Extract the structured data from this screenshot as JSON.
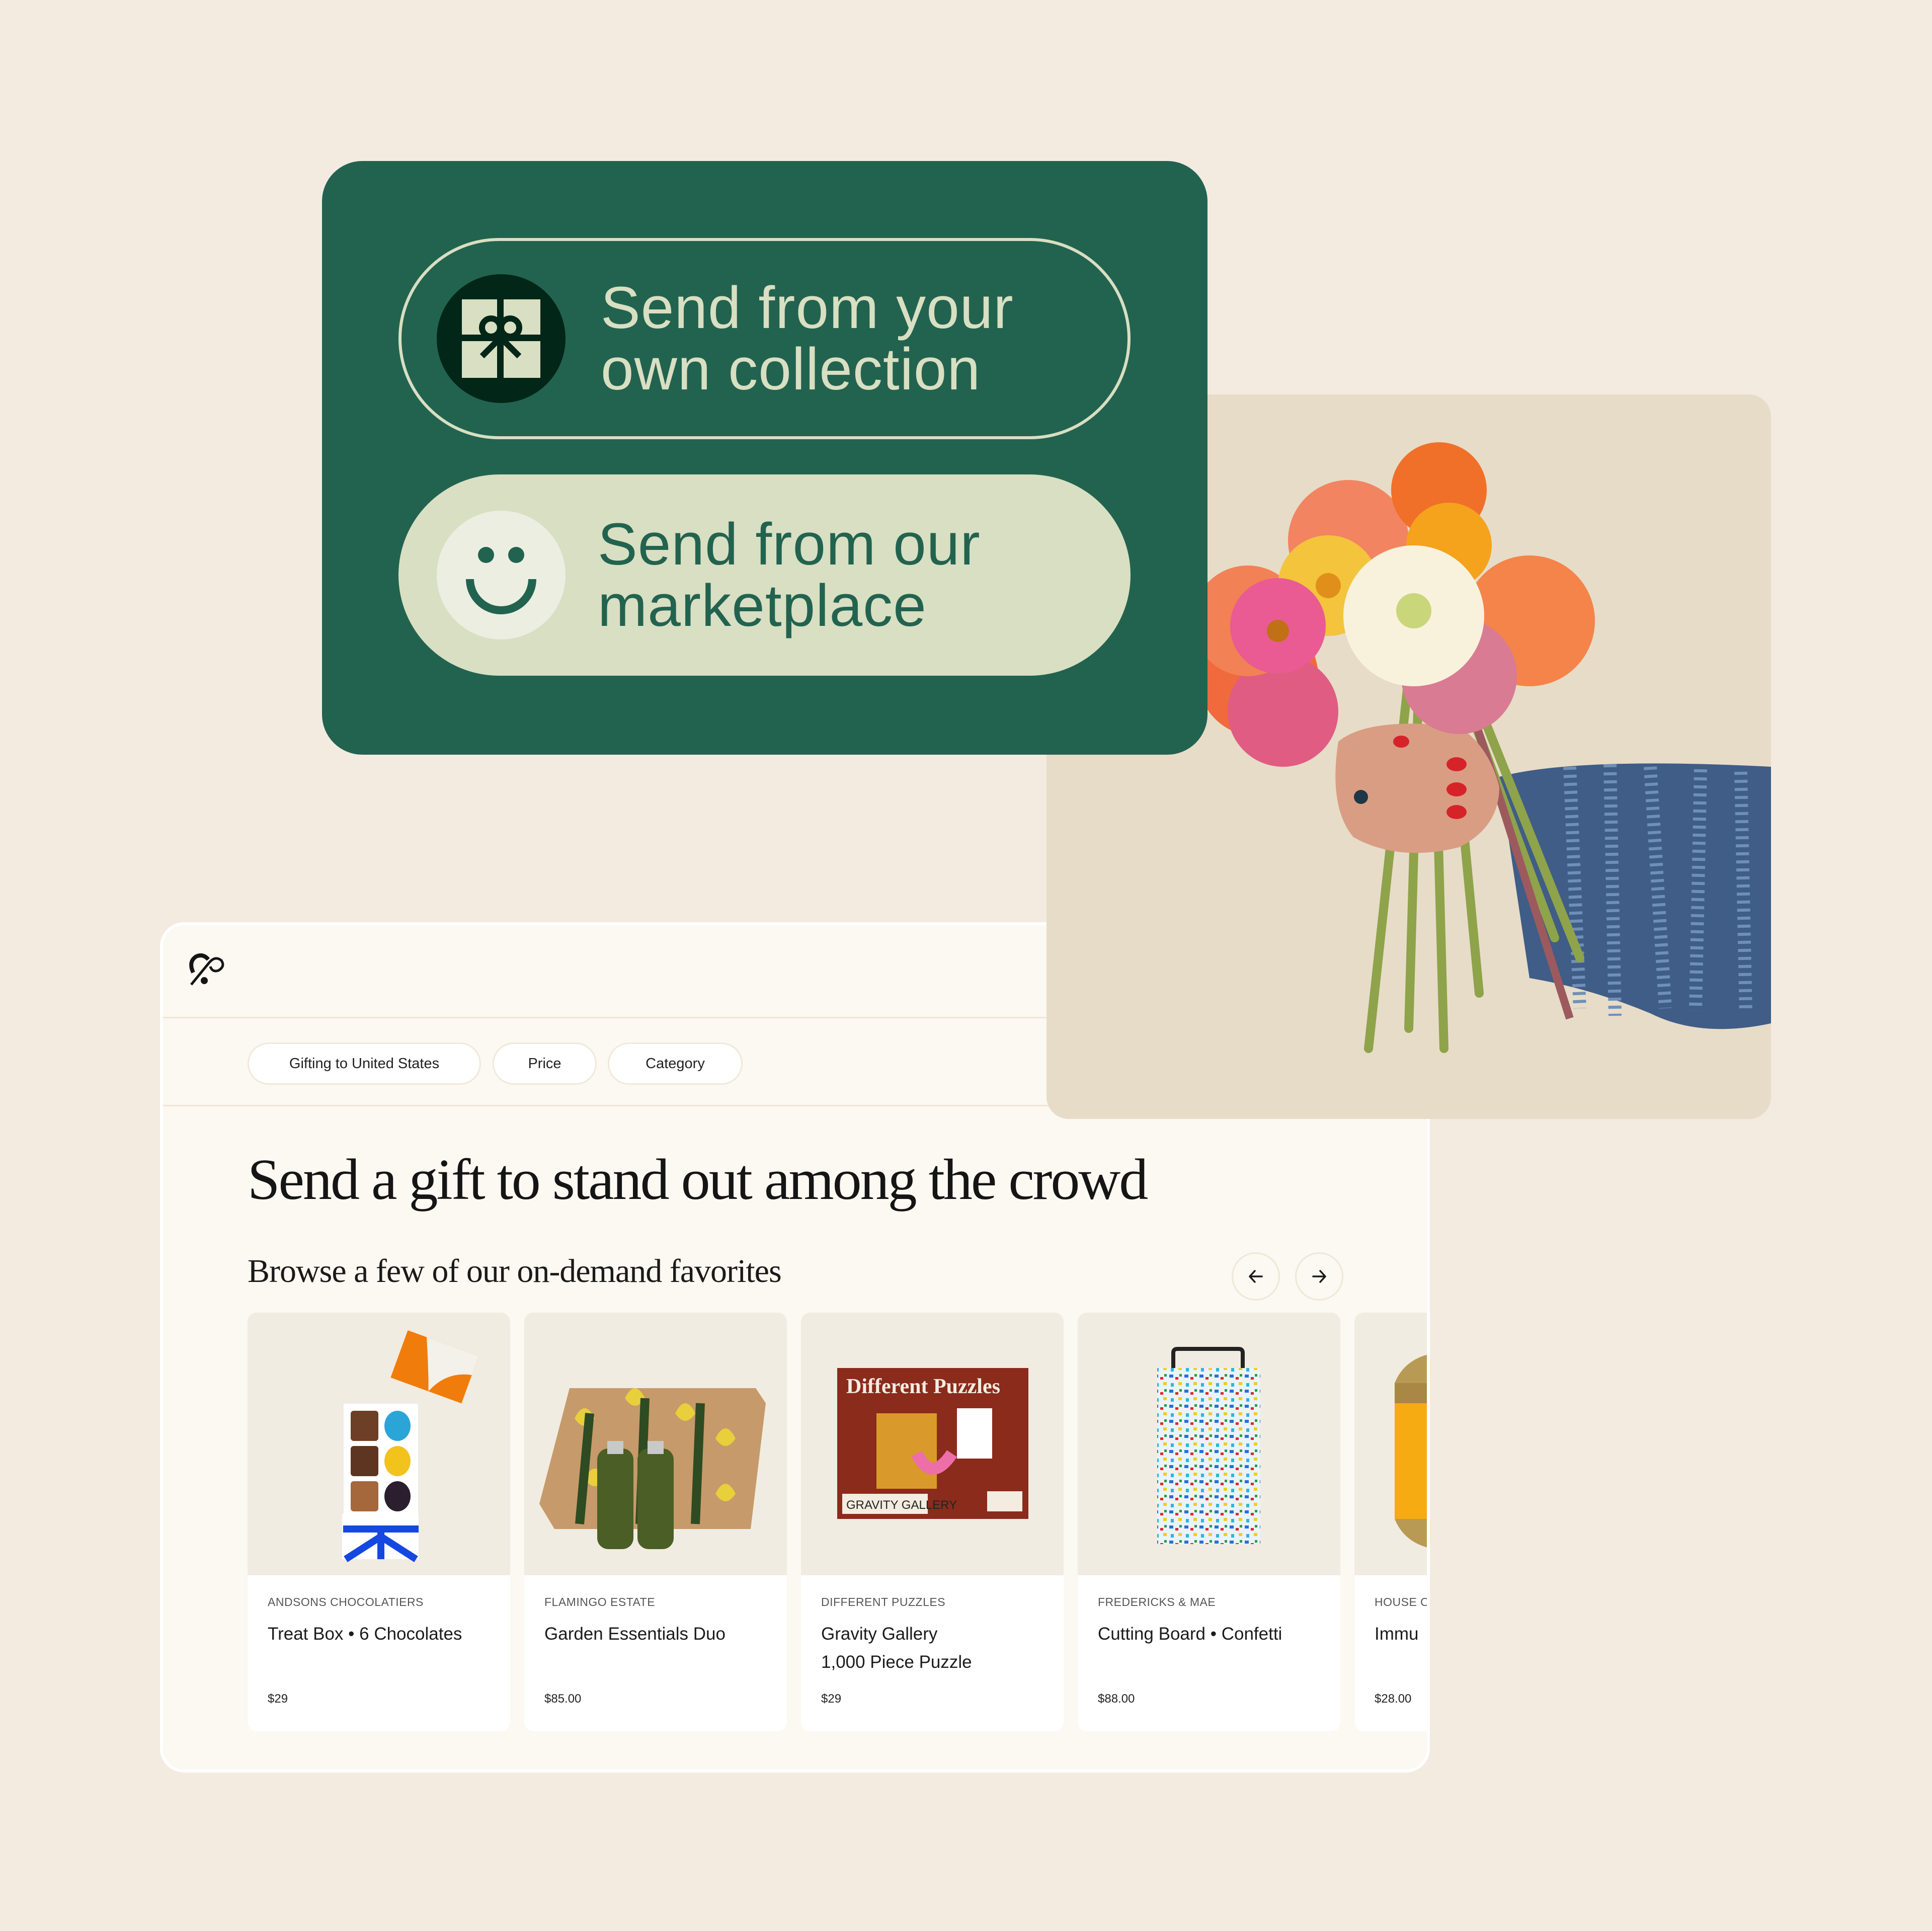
{
  "options": {
    "own_collection": {
      "line1": "Send from your",
      "line2": "own collection",
      "icon": "gift-icon"
    },
    "marketplace": {
      "line1": "Send from our",
      "line2": "marketplace",
      "icon": "smiley-icon"
    }
  },
  "photo": {
    "alt": "Hand holding a bouquet of zinnia flowers"
  },
  "marketplace_window": {
    "logo": "loop-logo-icon",
    "filters": [
      "Gifting to United States",
      "Price",
      "Category"
    ],
    "headline": "Send a gift to stand out among the crowd",
    "subheadline": "Browse a few of our on-demand favorites",
    "nav": {
      "prev": "arrow-left-icon",
      "next": "arrow-right-icon"
    },
    "products": [
      {
        "brand": "ANDSONS CHOCOLATIERS",
        "name_line1": "Treat Box • 6 Chocolates",
        "name_line2": "",
        "price": "$29"
      },
      {
        "brand": "FLAMINGO ESTATE",
        "name_line1": "Garden Essentials Duo",
        "name_line2": "",
        "price": "$85.00"
      },
      {
        "brand": "DIFFERENT PUZZLES",
        "name_line1": "Gravity Gallery",
        "name_line2": "1,000 Piece Puzzle",
        "price": "$29"
      },
      {
        "brand": "FREDERICKS & MAE",
        "name_line1": "Cutting Board • Confetti",
        "name_line2": "",
        "price": "$88.00"
      },
      {
        "brand": "HOUSE O",
        "name_line1": "Immu",
        "name_line2": "",
        "price": "$28.00"
      }
    ]
  },
  "colors": {
    "page_bg": "#f3ebe0",
    "brand_green": "#226350",
    "dark_green": "#022618",
    "sage": "#d9dfc2",
    "window_bg": "#fcf8f2"
  }
}
